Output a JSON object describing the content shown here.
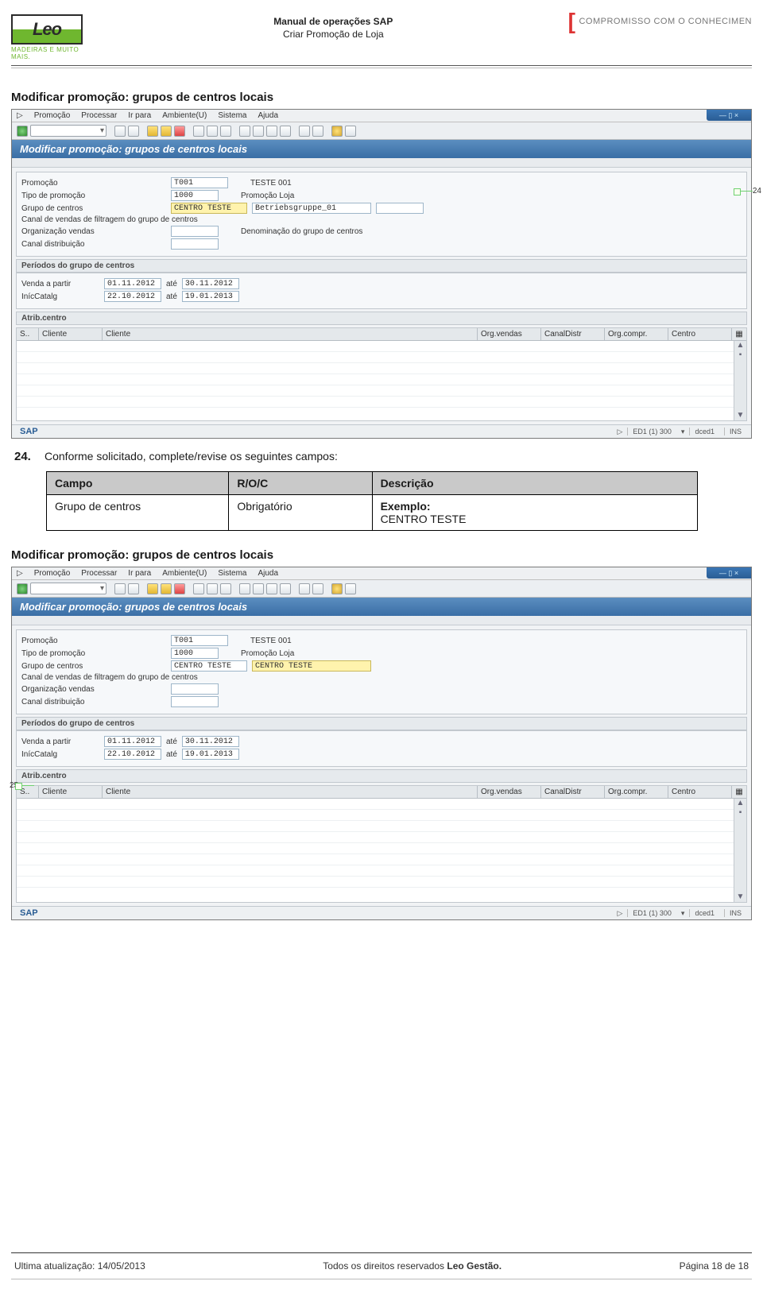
{
  "header": {
    "logo_text": "Leo",
    "logo_tag": "MADEIRAS E MUITO MAIS.",
    "title_line1": "Manual de operações SAP",
    "title_line2": "Criar Promoção de Loja",
    "brand_right": "COMPROMISSO COM O CONHECIMEN"
  },
  "section_title_1": "Modificar promoção: grupos de centros locais",
  "section_title_2": "Modificar promoção: grupos de centros locais",
  "instruction": {
    "number": "24.",
    "text": "Conforme solicitado, complete/revise os seguintes campos:"
  },
  "field_table": {
    "head_campo": "Campo",
    "head_roc": "R/O/C",
    "head_desc": "Descrição",
    "row1_campo": "Grupo de centros",
    "row1_roc": "Obrigatório",
    "row1_ex_lbl": "Exemplo:",
    "row1_ex_val": "CENTRO TESTE"
  },
  "sap": {
    "menu": {
      "m1": "Promoção",
      "m2": "Processar",
      "m3": "Ir para",
      "m4": "Ambiente(U)",
      "m5": "Sistema",
      "m6": "Ajuda"
    },
    "title": "Modificar promoção: grupos de centros locais",
    "form": {
      "promo_lbl": "Promoção",
      "promo_val": "T001",
      "promo_txt": "TESTE 001",
      "tipo_lbl": "Tipo de promoção",
      "tipo_val": "1000",
      "tipo_txt": "Promoção Loja",
      "grupo_lbl": "Grupo de centros",
      "grupo_val": "CENTRO TESTE",
      "grupo_txt1": "Betriebsgruppe_01",
      "grupo_txt2": "CENTRO TESTE",
      "canal_lbl": "Canal de vendas de filtragem do grupo de centros",
      "denom_lbl": "Denominação do grupo de centros",
      "org_lbl": "Organização vendas",
      "dist_lbl": "Canal distribuição"
    },
    "periodos": {
      "head": "Períodos do grupo de centros",
      "venda_lbl": "Venda a partir",
      "venda_v1": "01.11.2012",
      "venda_ate": "até",
      "venda_v2": "30.11.2012",
      "catlg_lbl": "InícCatalg",
      "catlg_v1": "22.10.2012",
      "catlg_v2": "19.01.2013"
    },
    "grid": {
      "head": "Atrib.centro",
      "c1": "S..",
      "c2": "Cliente",
      "c3": "Cliente",
      "c4": "Org.vendas",
      "c5": "CanalDistr",
      "c6": "Org.compr.",
      "c7": "Centro"
    },
    "status": {
      "sap": "SAP",
      "sys": "ED1 (1) 300",
      "srv": "dced1",
      "mode": "INS"
    }
  },
  "callout1": "24",
  "callout2": "25",
  "footer": {
    "left": "Ultima atualização: 14/05/2013",
    "mid_a": "Todos os direitos reservados ",
    "mid_b": "Leo Gestão.",
    "right": "Página 18 de 18"
  }
}
